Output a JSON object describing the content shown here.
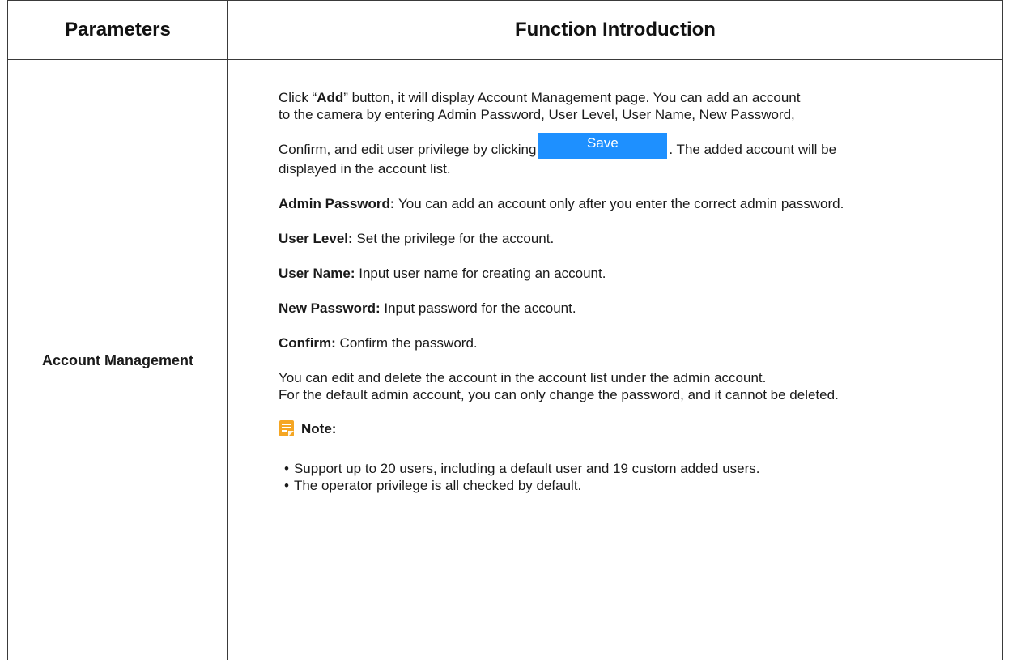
{
  "table": {
    "header": {
      "parameters": "Parameters",
      "function_intro": "Function Introduction"
    },
    "row": {
      "parameter": "Account Management",
      "intro": {
        "click": "Click “",
        "add": "Add",
        "line1_rest": "” button, it will display Account Management page. You can add an account",
        "line2": "to the camera by entering Admin Password, User Level, User Name, New Password,",
        "line3_pre": "Confirm, and edit user privilege by clicking",
        "save_button": "Save",
        "line3_post": ". The added account will be",
        "line4": "displayed in the account list."
      },
      "fields": [
        {
          "label": "Admin Password:",
          "text": " You can add an account only after you enter the correct admin password."
        },
        {
          "label": "User Level:",
          "text": " Set the privilege for the account."
        },
        {
          "label": "User Name:",
          "text": " Input user name for creating an account."
        },
        {
          "label": "New Password:",
          "text": " Input password for the account."
        },
        {
          "label": "Confirm:",
          "text": " Confirm the password."
        }
      ],
      "edit_line1": "You can edit and delete the account in the account list under the admin account.",
      "edit_line2": "For the default admin account, you can only change the password, and it cannot be deleted.",
      "note": {
        "label": "Note:",
        "icon": "note-icon",
        "items": [
          "Support up to 20 users, including a default user and 19 custom added users.",
          "The operator privilege is all checked by default."
        ]
      }
    }
  },
  "colors": {
    "accent": "#1e90ff",
    "note_icon": "#f5a623",
    "border": "#3a3a3a"
  }
}
